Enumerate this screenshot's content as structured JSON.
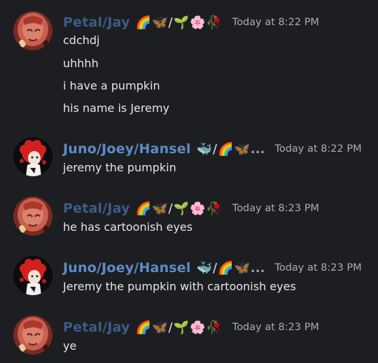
{
  "messages": [
    {
      "user": "Petal/Jay",
      "flair": "🌈🦋/🌱🌸🥀",
      "flair_truncated": false,
      "time": "Today at 8:22 PM",
      "avatar": "petal-avatar",
      "lines": [
        "cdchdj",
        "uhhhh",
        "i have a pumpkin",
        "his name is Jeremy"
      ]
    },
    {
      "user": "Juno/Joey/Hansel",
      "flair": "🐳/🌈🦋",
      "flair_truncated": true,
      "ellipsis": "...",
      "time": "Today at 8:22 PM",
      "avatar": "juno-avatar",
      "lines": [
        "jeremy the pumpkin"
      ]
    },
    {
      "user": "Petal/Jay",
      "flair": "🌈🦋/🌱🌸🥀",
      "flair_truncated": false,
      "time": "Today at 8:23 PM",
      "avatar": "petal-avatar",
      "lines": [
        "he has cartoonish eyes"
      ]
    },
    {
      "user": "Juno/Joey/Hansel",
      "flair": "🐳/🌈🦋",
      "flair_truncated": true,
      "ellipsis": "...",
      "time": "Today at 8:23 PM",
      "avatar": "juno-avatar",
      "lines": [
        "Jeremy the pumpkin with cartoonish eyes"
      ]
    },
    {
      "user": "Petal/Jay",
      "flair": "🌈🦋/🌱🌸🥀",
      "flair_truncated": false,
      "time": "Today at 8:23 PM",
      "avatar": "petal-avatar",
      "lines": [
        "ye"
      ]
    }
  ],
  "colors": {
    "background": "#1d1e22",
    "petal_name": "#3d5c86",
    "juno_name": "#5d8cc6",
    "timestamp": "#a8adb3",
    "message_text": "#e6e7e9"
  }
}
